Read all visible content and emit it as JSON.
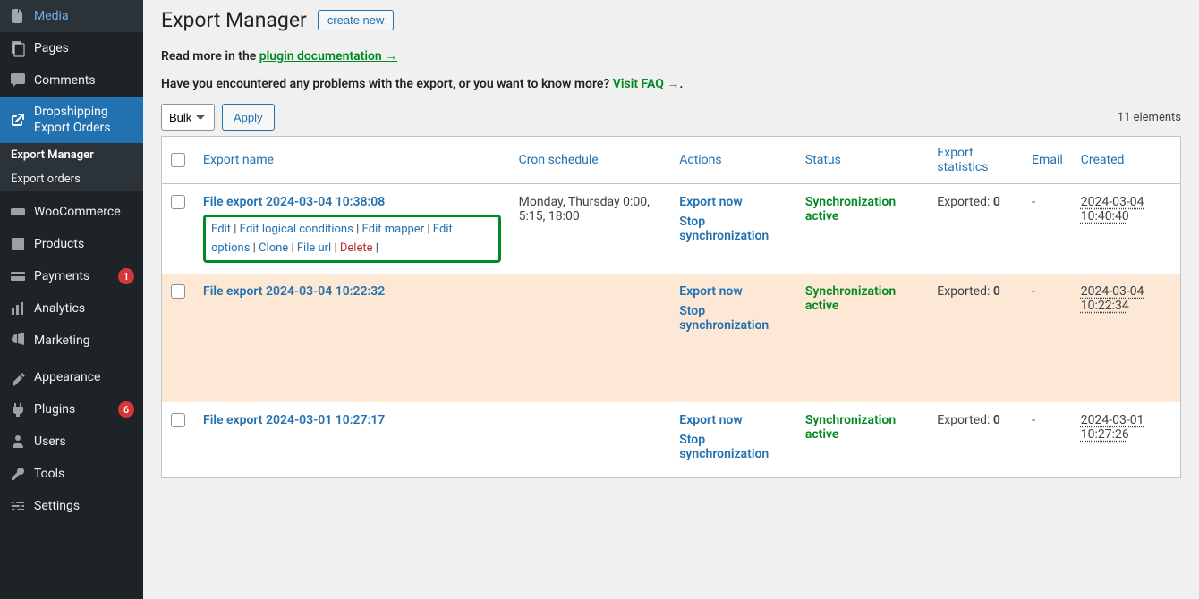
{
  "sidebar": {
    "items": [
      {
        "label": "Media"
      },
      {
        "label": "Pages"
      },
      {
        "label": "Comments"
      },
      {
        "label": "Dropshipping Export Orders"
      },
      {
        "label": "WooCommerce"
      },
      {
        "label": "Products"
      },
      {
        "label": "Payments",
        "badge": "1"
      },
      {
        "label": "Analytics"
      },
      {
        "label": "Marketing"
      },
      {
        "label": "Appearance"
      },
      {
        "label": "Plugins",
        "badge": "6"
      },
      {
        "label": "Users"
      },
      {
        "label": "Tools"
      },
      {
        "label": "Settings"
      }
    ],
    "submenu": [
      {
        "label": "Export Manager"
      },
      {
        "label": "Export orders"
      }
    ]
  },
  "header": {
    "title": "Export Manager",
    "create_btn": "create new"
  },
  "info": {
    "read_prefix": "Read more in the ",
    "doc_link": "plugin documentation →",
    "faq_prefix": "Have you encountered any problems with the export, or you want to know more? ",
    "faq_link": "Visit FAQ →",
    "faq_suffix": "."
  },
  "toolbar": {
    "bulk_label": "Bulk",
    "apply_label": "Apply",
    "count": "11 elements"
  },
  "columns": {
    "export_name": "Export name",
    "cron": "Cron schedule",
    "actions": "Actions",
    "status": "Status",
    "stats": "Export statistics",
    "email": "Email",
    "created": "Created"
  },
  "row_actions": {
    "edit": "Edit",
    "edit_logical": "Edit logical conditions",
    "edit_mapper": "Edit mapper",
    "edit_options": "Edit options",
    "clone": "Clone",
    "file_url": "File url",
    "delete": "Delete"
  },
  "action_links": {
    "export_now": "Export now",
    "stop_sync": "Stop synchronization"
  },
  "status_text": "Synchronization active",
  "exported_label": "Exported: ",
  "rows": [
    {
      "name": "File export 2024-03-04 10:38:08",
      "cron": "Monday, Thursday 0:00, 5:15, 18:00",
      "exported": "0",
      "email": "-",
      "created": "2024-03-04 10:40:40"
    },
    {
      "name": "File export 2024-03-04 10:22:32",
      "cron": "",
      "exported": "0",
      "email": "-",
      "created": "2024-03-04 10:22:34"
    },
    {
      "name": "File export 2024-03-01 10:27:17",
      "cron": "",
      "exported": "0",
      "email": "-",
      "created": "2024-03-01 10:27:26"
    }
  ]
}
